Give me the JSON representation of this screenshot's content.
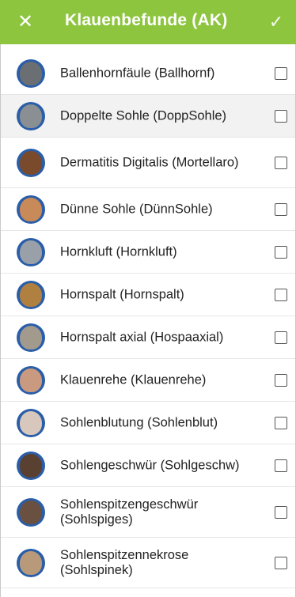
{
  "header": {
    "title": "Klauenbefunde (AK)",
    "close_glyph": "✕",
    "confirm_glyph": "✓",
    "bar_color": "#8dc53e"
  },
  "items": [
    {
      "label": "Ballenhornfäule (Ballhornf)",
      "checked": false,
      "photo": "#6b6f73",
      "selected_row": false
    },
    {
      "label": "Doppelte Sohle (DoppSohle)",
      "checked": false,
      "photo": "#8a8f94",
      "selected_row": true
    },
    {
      "label": "Dermatitis Digitalis (Mortellaro)",
      "checked": false,
      "photo": "#7a4a2c",
      "selected_row": false
    },
    {
      "label": "Dünne Sohle (DünnSohle)",
      "checked": false,
      "photo": "#c98a5a",
      "selected_row": false
    },
    {
      "label": "Hornkluft (Hornkluft)",
      "checked": false,
      "photo": "#9aa0a8",
      "selected_row": false
    },
    {
      "label": "Hornspalt (Hornspalt)",
      "checked": false,
      "photo": "#b08040",
      "selected_row": false
    },
    {
      "label": "Hornspalt axial (Hospaaxial)",
      "checked": false,
      "photo": "#a39a8e",
      "selected_row": false
    },
    {
      "label": "Klauenrehe (Klauenrehe)",
      "checked": false,
      "photo": "#c99a80",
      "selected_row": false
    },
    {
      "label": "Sohlenblutung (Sohlenblut)",
      "checked": false,
      "photo": "#d8c7bd",
      "selected_row": false
    },
    {
      "label": "Sohlengeschwür (Sohlgeschw)",
      "checked": false,
      "photo": "#5a4030",
      "selected_row": false
    },
    {
      "label": "Sohlenspitzengeschwür (Sohlspiges)",
      "checked": false,
      "photo": "#6a5040",
      "selected_row": false
    },
    {
      "label": "Sohlenspitzennekrose (Sohlspinek)",
      "checked": false,
      "photo": "#b89a7a",
      "selected_row": false
    }
  ]
}
